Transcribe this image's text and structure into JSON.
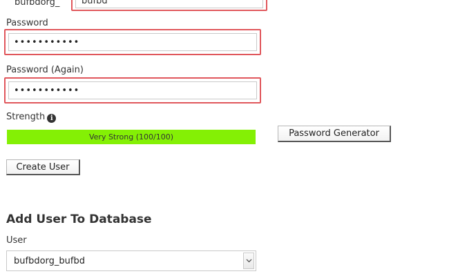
{
  "add_user": {
    "username_prefix": "bufbdorg_",
    "username_value": "bufbd",
    "password_label": "Password",
    "password_value": "•••••••••••",
    "password_again_label": "Password (Again)",
    "password_again_value": "•••••••••••",
    "strength_label": "Strength",
    "strength_text": "Very Strong (100/100)",
    "strength_percent": 100,
    "generator_button": "Password Generator",
    "create_button": "Create User"
  },
  "add_user_to_db": {
    "title": "Add User To Database",
    "user_label": "User",
    "user_selected": "bufbdorg_bufbd"
  },
  "colors": {
    "highlight": "#e0565b",
    "strength_bar": "#84f005"
  },
  "icons": {
    "info": "info-icon",
    "dropdown": "chevron-down-icon"
  }
}
